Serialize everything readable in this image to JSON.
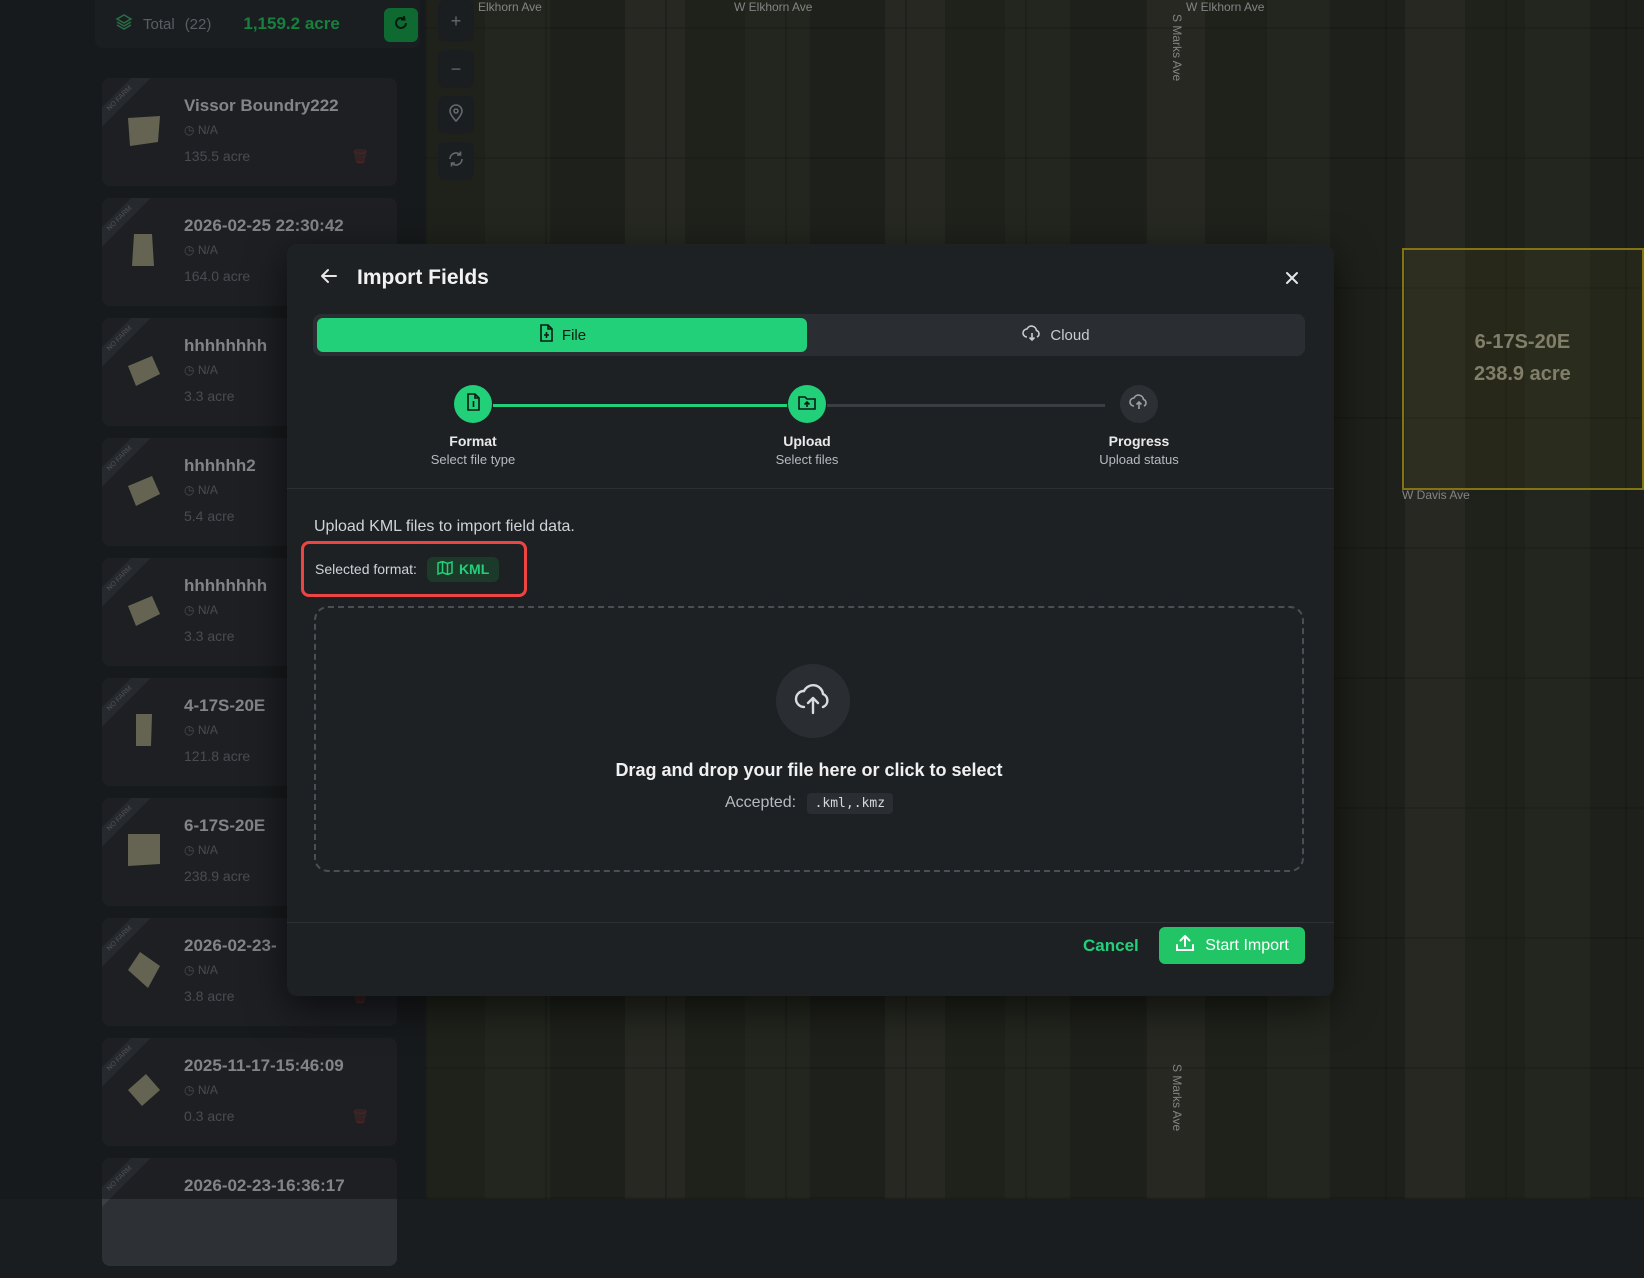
{
  "sidebar": {
    "total_label": "Total",
    "total_count": "(22)",
    "total_area": "1,159.2 acre",
    "fields": [
      {
        "name": "Vissor Boundry222",
        "meta": "N/A",
        "area": "135.5 acre",
        "ribbon": "NO FARM"
      },
      {
        "name": "2026-02-25 22:30:42",
        "meta": "N/A",
        "area": "164.0 acre",
        "ribbon": "NO FARM"
      },
      {
        "name": "hhhhhhhh",
        "meta": "N/A",
        "area": "3.3 acre",
        "ribbon": "NO FARM"
      },
      {
        "name": "hhhhhh2",
        "meta": "N/A",
        "area": "5.4 acre",
        "ribbon": "NO FARM"
      },
      {
        "name": "hhhhhhhh",
        "meta": "N/A",
        "area": "3.3 acre",
        "ribbon": "NO FARM"
      },
      {
        "name": "4-17S-20E",
        "meta": "N/A",
        "area": "121.8 acre",
        "ribbon": "NO FARM"
      },
      {
        "name": "6-17S-20E",
        "meta": "N/A",
        "area": "238.9 acre",
        "ribbon": "NO FARM"
      },
      {
        "name": "2026-02-23-",
        "meta": "N/A",
        "area": "3.8 acre",
        "ribbon": "NO FARM"
      },
      {
        "name": "2025-11-17-15:46:09",
        "meta": "N/A",
        "area": "0.3 acre",
        "ribbon": "NO FARM"
      },
      {
        "name": "2026-02-23-16:36:17",
        "meta": "",
        "area": "",
        "ribbon": "NO FARM"
      }
    ]
  },
  "map": {
    "labels": {
      "elkhorn_1": "Elkhorn Ave",
      "elkhorn_2": "W Elkhorn Ave",
      "elkhorn_3": "W Elkhorn Ave",
      "marks_1": "S Marks Ave",
      "marks_2": "S Marks Ave",
      "davis": "W Davis Ave"
    },
    "highlight": {
      "name": "6-17S-20E",
      "area": "238.9 acre",
      "color": "#c8b31f"
    }
  },
  "modal": {
    "title": "Import Fields",
    "tabs": [
      {
        "label": "File",
        "icon": "file-icon",
        "active": true
      },
      {
        "label": "Cloud",
        "icon": "cloud-icon",
        "active": false
      }
    ],
    "steps": [
      {
        "title": "Format",
        "subtitle": "Select file type",
        "state": "done"
      },
      {
        "title": "Upload",
        "subtitle": "Select files",
        "state": "done"
      },
      {
        "title": "Progress",
        "subtitle": "Upload status",
        "state": "pending"
      }
    ],
    "description": "Upload KML files to import field data.",
    "selected_format_label": "Selected format:",
    "selected_format_value": "KML",
    "dropzone": {
      "title": "Drag and drop your file here or click to select",
      "accepted_label": "Accepted:",
      "accepted_value": ".kml,.kmz"
    },
    "cancel_label": "Cancel",
    "start_label": "Start Import",
    "accent_color": "#22d07a",
    "highlight_border_color": "#ef4444"
  }
}
